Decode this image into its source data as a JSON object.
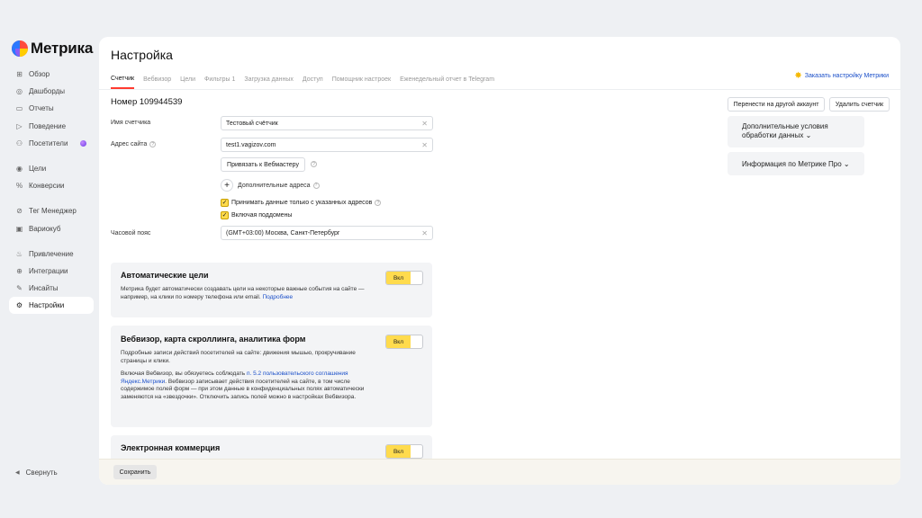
{
  "app": {
    "logo_text": "Метрика"
  },
  "sidebar": {
    "items": [
      {
        "label": "Обзор",
        "icon": "grid-icon"
      },
      {
        "label": "Дашборды",
        "icon": "dashboard-icon"
      },
      {
        "label": "Отчеты",
        "icon": "reports-icon"
      },
      {
        "label": "Поведение",
        "icon": "play-icon"
      },
      {
        "label": "Посетители",
        "icon": "users-icon"
      },
      {
        "label": "Цели",
        "icon": "target-icon"
      },
      {
        "label": "Конверсии",
        "icon": "percent-icon"
      },
      {
        "label": "Тег Менеджер",
        "icon": "tag-icon"
      },
      {
        "label": "Вариокуб",
        "icon": "cube-icon"
      },
      {
        "label": "Привлечение",
        "icon": "fire-icon"
      },
      {
        "label": "Интеграции",
        "icon": "integrations-icon"
      },
      {
        "label": "Инсайты",
        "icon": "magic-wand-icon"
      },
      {
        "label": "Настройки",
        "icon": "gear-icon"
      }
    ],
    "collapse_label": "Свернуть"
  },
  "header": {
    "title": "Настройка",
    "tabs": [
      "Счетчик",
      "Вебвизор",
      "Цели",
      "Фильтры 1",
      "Загрузка данных",
      "Доступ",
      "Помощник настроек",
      "Еженедельный отчет в Telegram"
    ],
    "active_tab": "Счетчик",
    "order_setup_link": "Заказать настройку Метрики"
  },
  "counter": {
    "number_label": "Номер 109944539",
    "move_button": "Перенести на другой аккаунт",
    "delete_button": "Удалить счетчик",
    "name_label": "Имя счетчика",
    "name_value": "Тестовый счётчик",
    "site_label": "Адрес сайта",
    "site_value": "test1.vagizov.com",
    "webmaster_button": "Привязать к Вебмастеру",
    "additional_addresses": "Дополнительные адреса",
    "only_listed_label": "Принимать данные только с указанных адресов",
    "include_subdomains_label": "Включая поддомены",
    "timezone_label": "Часовой пояс",
    "timezone_value": "(GMT+03:00) Москва, Санкт-Петербург"
  },
  "panels": {
    "auto_goals": {
      "title": "Автоматические цели",
      "text": "Метрика будет автоматически создавать цели на некоторые важные события на сайте — например, на клики по номеру телефона или email.",
      "link": "Подробнее",
      "toggle": "Вкл"
    },
    "webvisor": {
      "title": "Вебвизор, карта скроллинга, аналитика форм",
      "text1": "Подробные записи действий посетителей на сайте: движения мышью, прокручивание страницы и клики.",
      "text2_a": "Включая Вебвизор, вы обязуетесь соблюдать",
      "text2_link": "п. 5.2 пользовательского соглашения Яндекс.Метрики",
      "text2_b": ". Вебвизор записывает действия посетителей на сайте, в том числе содержимое полей форм — при этом данные в конфиденциальных полях автоматически заменяются на «звездочки». Отключить запись полей можно в настройках Вебвизора.",
      "toggle": "Вкл"
    },
    "ecommerce": {
      "title": "Электронная коммерция",
      "toggle": "Вкл"
    }
  },
  "side": {
    "extra_conditions": "Дополнительные условия обработки данных",
    "metrika_pro": "Информация по Метрике Про"
  },
  "footer": {
    "save_button": "Сохранить"
  },
  "colors": {
    "accent_yellow": "#ffdb4d",
    "link_blue": "#1a4fc9",
    "active_tab_underline": "#ff3b30"
  }
}
